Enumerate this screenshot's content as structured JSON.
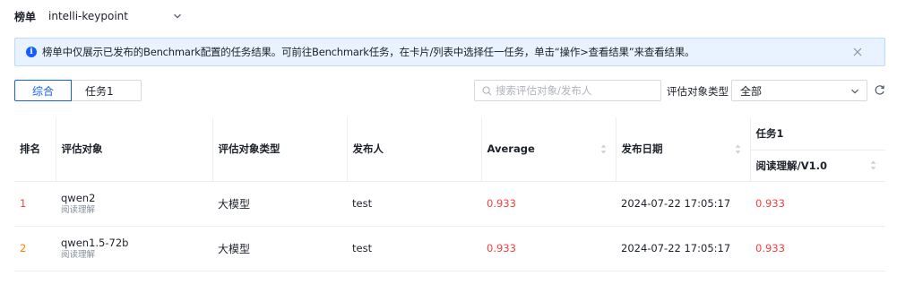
{
  "header": {
    "label": "榜单",
    "selected": "intelli-keypoint"
  },
  "alert": {
    "text": "榜单中仅展示已发布的Benchmark配置的任务结果。可前往Benchmark任务，在卡片/列表中选择任一任务，单击“操作>查看结果”来查看结果。"
  },
  "tabs": [
    {
      "label": "综合",
      "active": true
    },
    {
      "label": "任务1",
      "active": false
    }
  ],
  "search": {
    "placeholder": "搜索评估对象/发布人",
    "value": ""
  },
  "filter": {
    "label": "评估对象类型",
    "selected": "全部"
  },
  "table": {
    "columns": {
      "rank": "排名",
      "object": "评估对象",
      "type": "评估对象类型",
      "publisher": "发布人",
      "average": "Average",
      "date": "发布日期",
      "group": "任务1",
      "sub": "阅读理解/V1.0"
    },
    "rows": [
      {
        "rank": "1",
        "name": "qwen2",
        "sub": "阅读理解",
        "type": "大模型",
        "publisher": "test",
        "average": "0.933",
        "date": "2024-07-22 17:05:17",
        "task_score": "0.933"
      },
      {
        "rank": "2",
        "name": "qwen1.5-72b",
        "sub": "阅读理解",
        "type": "大模型",
        "publisher": "test",
        "average": "0.933",
        "date": "2024-07-22 17:05:17",
        "task_score": "0.933"
      }
    ]
  },
  "colors": {
    "accent": "#165dff",
    "score": "#f53f3f",
    "rank2": "#ff7d00"
  }
}
